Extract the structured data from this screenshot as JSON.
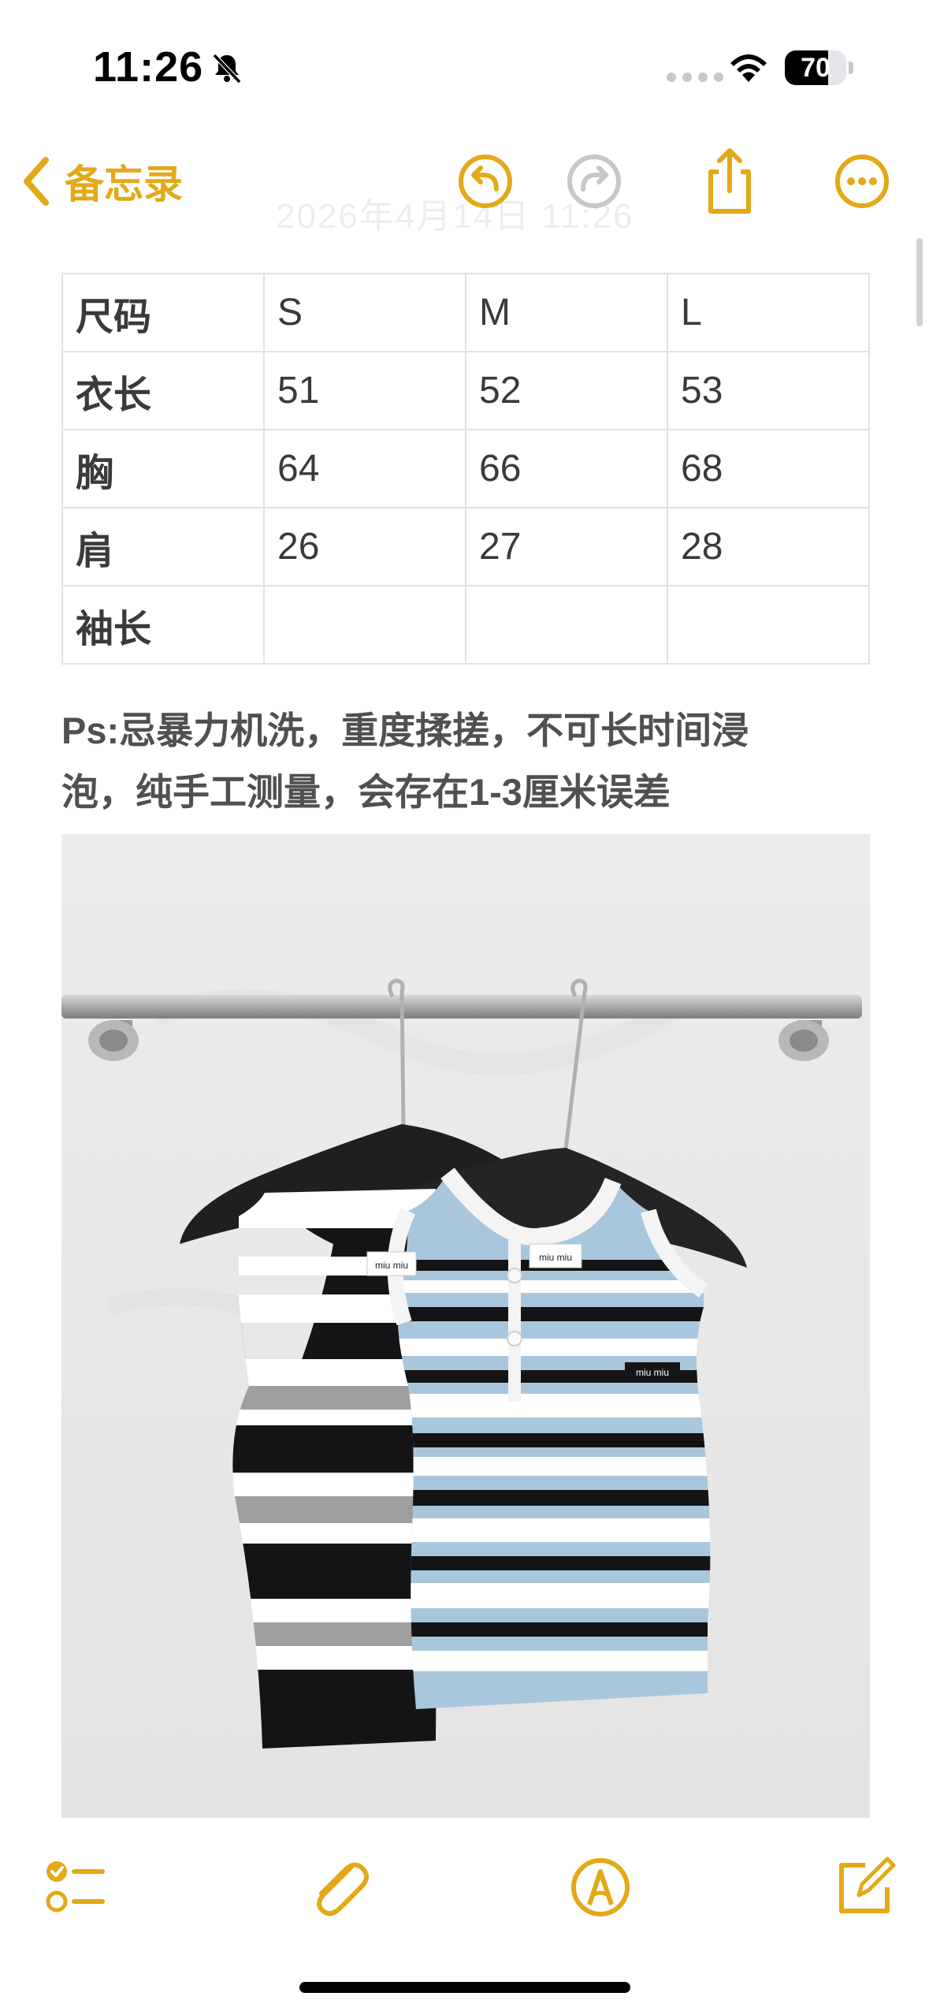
{
  "status_bar": {
    "time": "11:26",
    "battery_level": "70",
    "battery_fraction": 0.7,
    "icons": [
      "bell-slash-icon",
      "cellular-signal-icon",
      "wifi-icon",
      "battery-icon"
    ]
  },
  "nav": {
    "back_label": "备忘录",
    "faded_date": "2026年4月14日 11:26",
    "icons": [
      "chevron-left-icon",
      "undo-icon",
      "redo-icon",
      "share-icon",
      "more-icon"
    ]
  },
  "accent_color": "#e3a917",
  "table": {
    "rows": [
      [
        "尺码",
        "S",
        "M",
        "L"
      ],
      [
        "衣长",
        "51",
        "52",
        "53"
      ],
      [
        "胸",
        "64",
        "66",
        "68"
      ],
      [
        "肩",
        "26",
        "27",
        "28"
      ],
      [
        "袖长",
        "",
        "",
        ""
      ]
    ]
  },
  "note": {
    "line1": "Ps:忌暴力机洗，重度揉搓，不可长时间浸",
    "line2": "泡，纯手工测量，会存在1-3厘米误差"
  },
  "photo": {
    "label_left": "miu miu",
    "label_right": "miu miu",
    "patch_text": "miu miu"
  },
  "toolbar": {
    "icons": [
      "checklist-icon",
      "paperclip-icon",
      "markup-pen-icon",
      "compose-icon"
    ]
  }
}
